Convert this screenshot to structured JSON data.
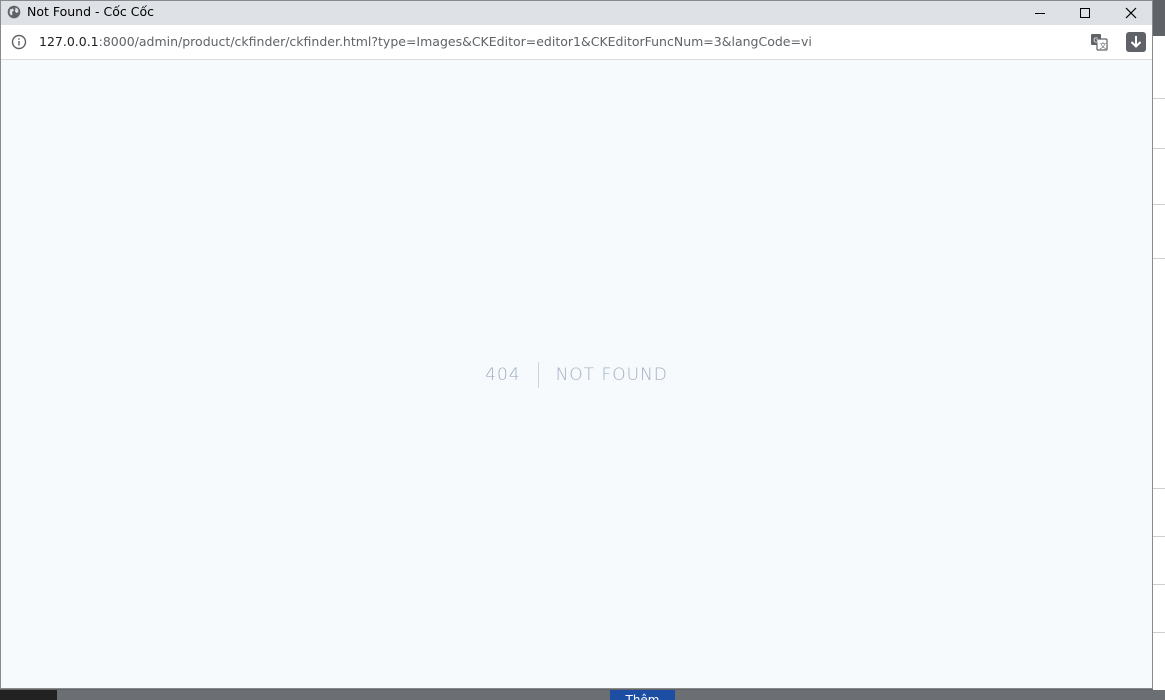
{
  "window": {
    "title": "Not Found - Cốc Cốc"
  },
  "address_bar": {
    "url_host": "127.0.0.1",
    "url_rest": ":8000/admin/product/ckfinder/ckfinder.html?type=Images&CKEditor=editor1&CKEditorFuncNum=3&langCode=vi"
  },
  "page": {
    "error_code": "404",
    "error_message": "NOT FOUND"
  },
  "background": {
    "button_label": "Thêm"
  },
  "colors": {
    "page_bg": "#f7fafc",
    "error_text": "#a0aec0",
    "titlebar_bg": "#dee1e6",
    "accent_button": "#1c4fa3"
  }
}
